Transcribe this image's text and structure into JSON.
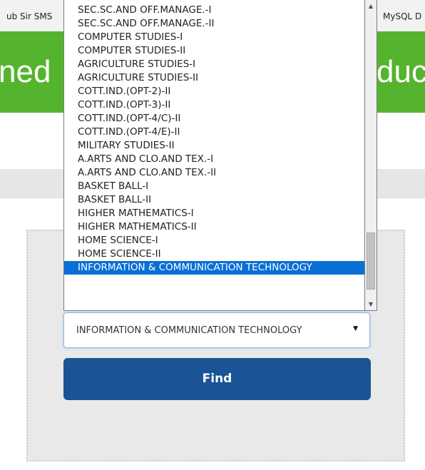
{
  "bookmarks": {
    "left_label": "ub Sir SMS",
    "right_label": "MySQL D"
  },
  "header": {
    "left_text": "ned",
    "right_text": "duc"
  },
  "form": {
    "selected_value": "INFORMATION & COMMUNICATION TECHNOLOGY",
    "select_arrow": "▼",
    "find_label": "Find"
  },
  "dropdown": {
    "options": [
      "SEC.SC.AND OFF.MANAGE.-I",
      "SEC.SC.AND OFF.MANAGE.-II",
      "COMPUTER STUDIES-I",
      "COMPUTER STUDIES-II",
      "AGRICULTURE STUDIES-I",
      "AGRICULTURE STUDIES-II",
      "COTT.IND.(OPT-2)-II",
      "COTT.IND.(OPT-3)-II",
      "COTT.IND.(OPT-4/C)-II",
      "COTT.IND.(OPT-4/E)-II",
      "MILITARY STUDIES-II",
      "A.ARTS AND CLO.AND TEX.-I",
      "A.ARTS AND CLO.AND TEX.-II",
      "BASKET BALL-I",
      "BASKET BALL-II",
      "HIGHER MATHEMATICS-I",
      "HIGHER MATHEMATICS-II",
      "HOME SCIENCE-I",
      "HOME SCIENCE-II",
      "INFORMATION & COMMUNICATION TECHNOLOGY"
    ],
    "selected_index": 19,
    "scroll_position_fraction": 0.96,
    "visible_fraction": 0.2
  },
  "colors": {
    "header_green": "#55b42e",
    "button_blue": "#1a5494",
    "selection_blue": "#0a6fd6"
  }
}
